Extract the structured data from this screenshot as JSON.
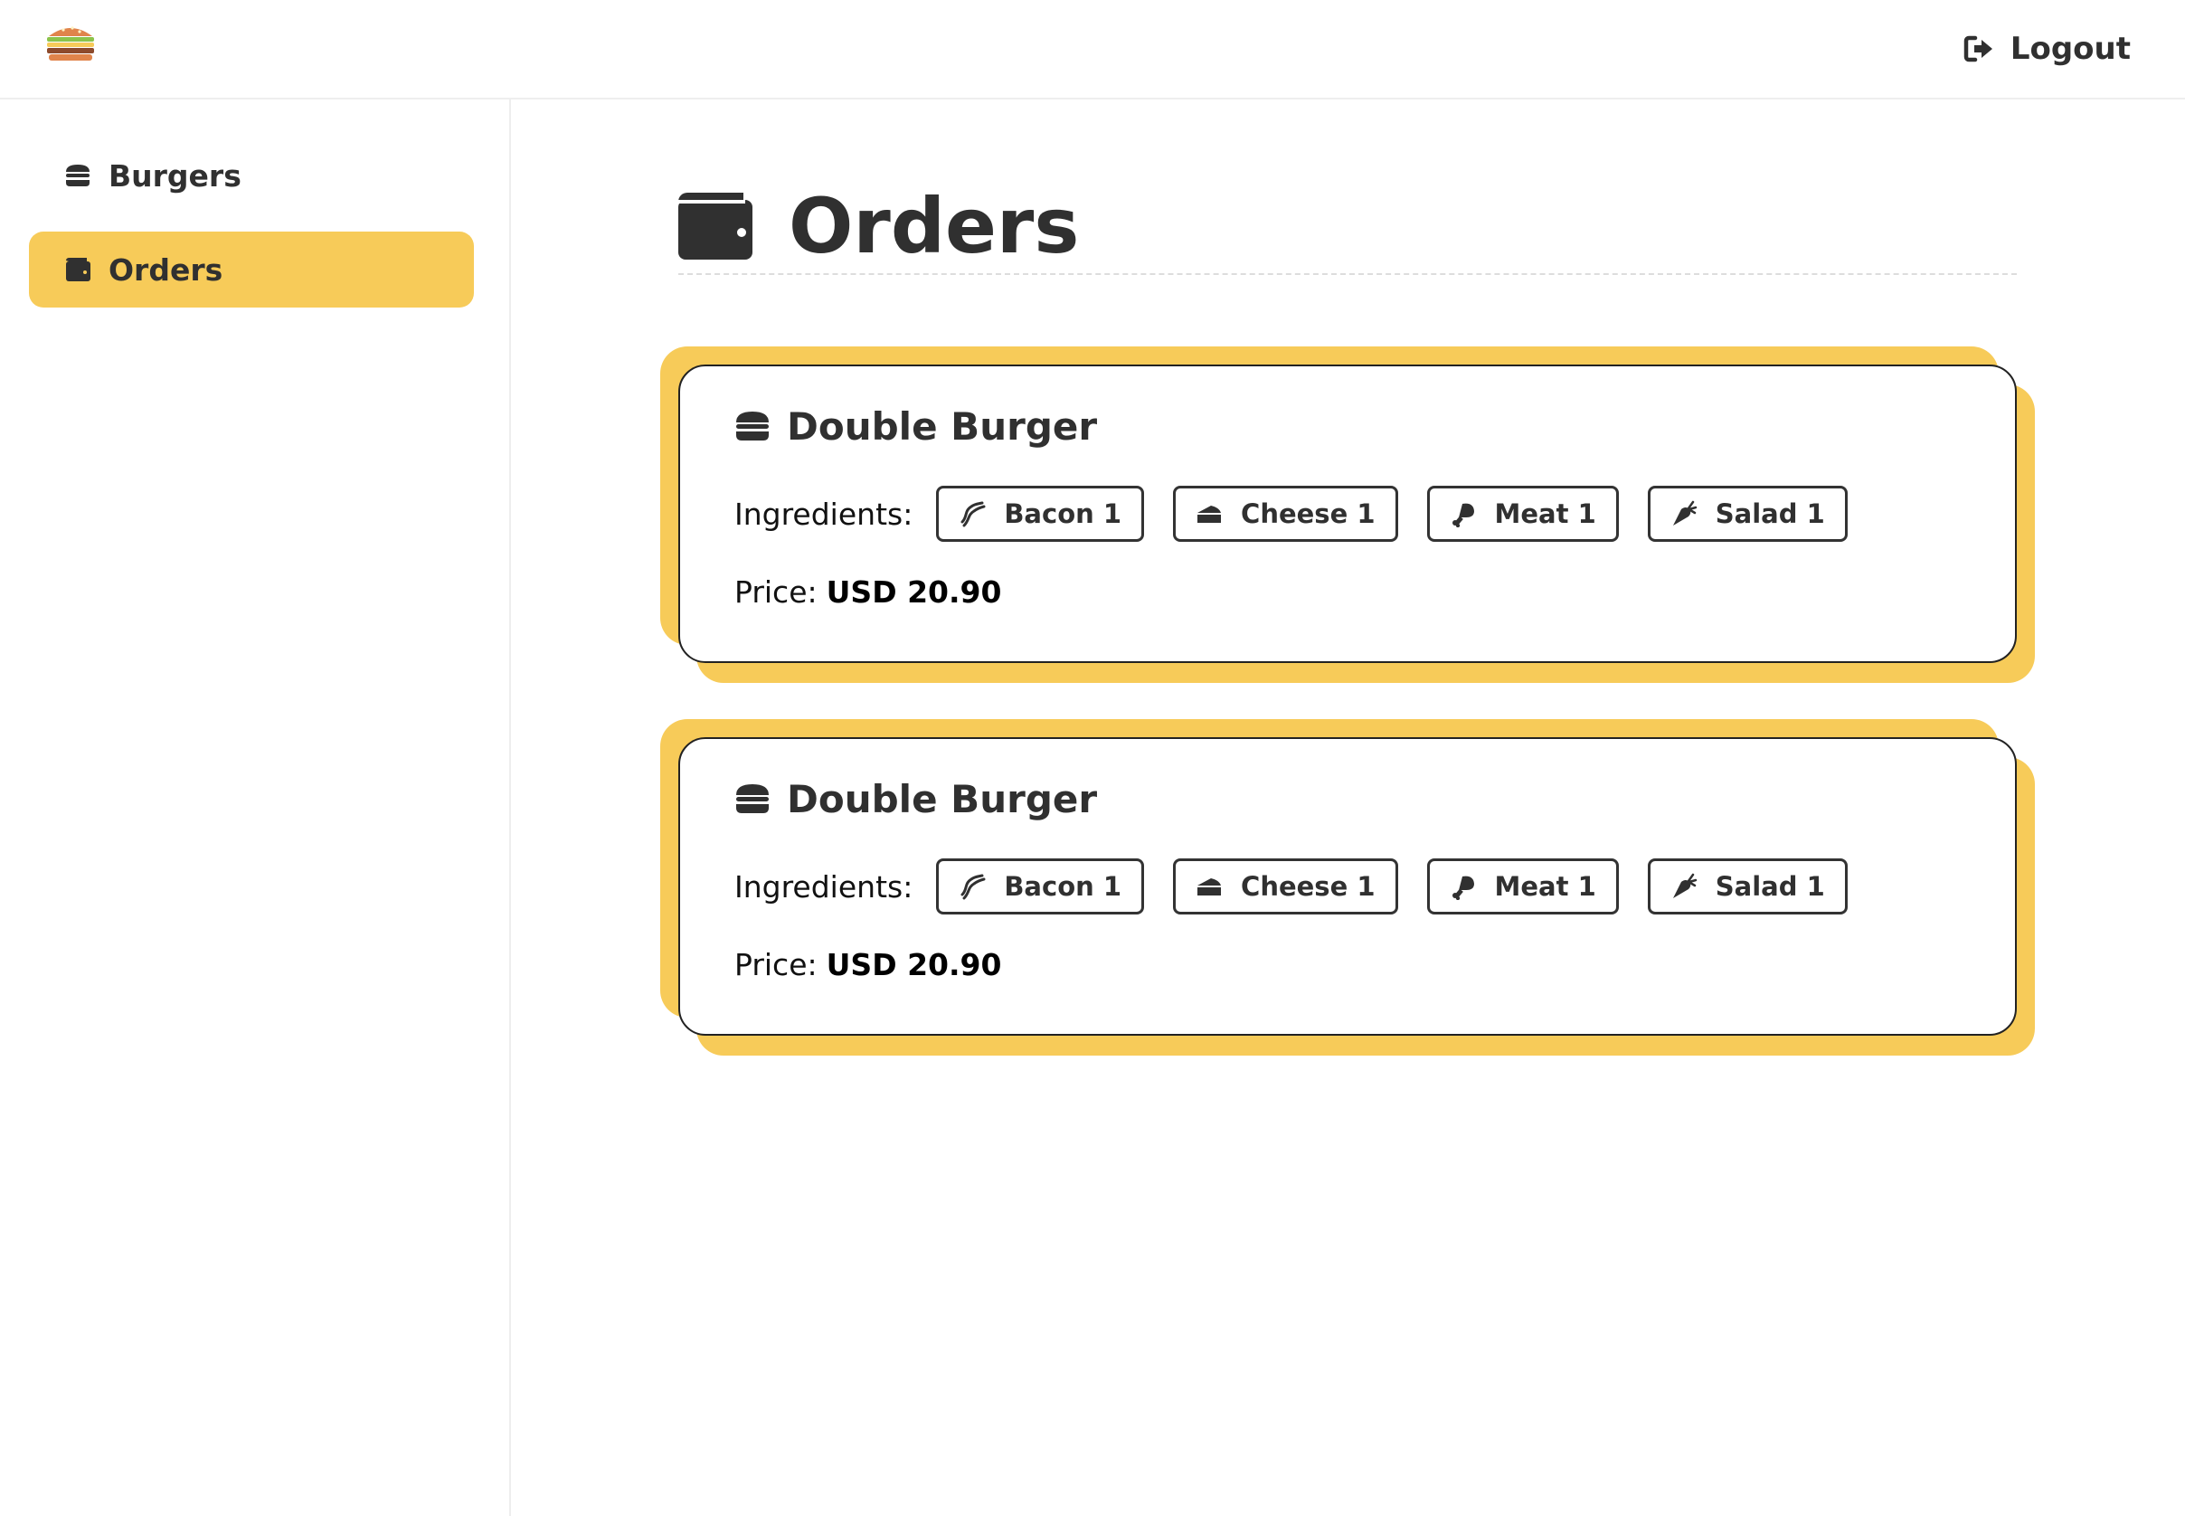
{
  "header": {
    "logo_icon": "burger-logo-icon",
    "logout_label": "Logout",
    "logout_icon": "sign-out-icon"
  },
  "sidebar": {
    "items": [
      {
        "label": "Burgers",
        "icon": "burger-icon",
        "active": false
      },
      {
        "label": "Orders",
        "icon": "wallet-icon",
        "active": true
      }
    ]
  },
  "main": {
    "title": "Orders",
    "title_icon": "wallet-icon"
  },
  "orders": [
    {
      "name": "Double Burger",
      "ingredients_label": "Ingredients:",
      "ingredients": [
        {
          "label": "Bacon 1",
          "icon": "bacon-icon"
        },
        {
          "label": "Cheese 1",
          "icon": "cheese-icon"
        },
        {
          "label": "Meat 1",
          "icon": "drumstick-icon"
        },
        {
          "label": "Salad 1",
          "icon": "carrot-icon"
        }
      ],
      "price_label": "Price:",
      "price": "USD 20.90"
    },
    {
      "name": "Double Burger",
      "ingredients_label": "Ingredients:",
      "ingredients": [
        {
          "label": "Bacon 1",
          "icon": "bacon-icon"
        },
        {
          "label": "Cheese 1",
          "icon": "cheese-icon"
        },
        {
          "label": "Meat 1",
          "icon": "drumstick-icon"
        },
        {
          "label": "Salad 1",
          "icon": "carrot-icon"
        }
      ],
      "price_label": "Price:",
      "price": "USD 20.90"
    }
  ],
  "colors": {
    "accent": "#f7cb59",
    "text": "#303030",
    "card_border": "#222222"
  }
}
